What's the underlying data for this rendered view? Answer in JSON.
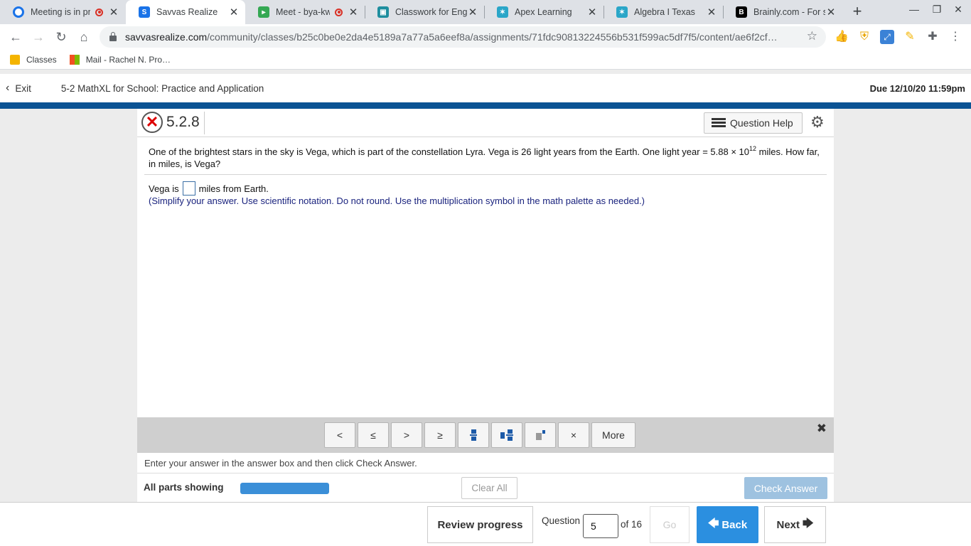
{
  "browser": {
    "tabs": [
      {
        "title": "Meeting is in pr",
        "favicon": "meeting-icon",
        "recording": true
      },
      {
        "title": "Savvas Realize",
        "favicon": "savvas-icon",
        "active": true
      },
      {
        "title": "Meet - bya-kwip",
        "favicon": "google-meet-icon",
        "recording": true
      },
      {
        "title": "Classwork for Engli",
        "favicon": "classroom-icon"
      },
      {
        "title": "Apex Learning",
        "favicon": "apex-icon"
      },
      {
        "title": "Algebra I Texas",
        "favicon": "apex-icon"
      },
      {
        "title": "Brainly.com - For st",
        "favicon": "brainly-icon"
      }
    ],
    "url_domain": "savvasrealize.com",
    "url_path": "/community/classes/b25c0be0e2da4e5189a7a77a5a6eef8a/assignments/71fdc90813224556b531f599ac5df7f5/content/ae6f2cf…",
    "bookmarks": [
      {
        "label": "Classes",
        "icon": "classroom-icon"
      },
      {
        "label": "Mail - Rachel N. Pro…",
        "icon": "microsoft-icon"
      }
    ]
  },
  "assignment": {
    "exit_label": "Exit",
    "title": "5-2 MathXL for School: Practice and Application",
    "due": "Due 12/10/20 11:59pm"
  },
  "question": {
    "number": "5.2.8",
    "help_label": "Question Help",
    "text_before": "One of the brightest stars in the sky is Vega, which is part of the constellation Lyra. Vega is 26 light years from the Earth. One light year = 5.88 × 10",
    "exponent": "12",
    "text_after": " miles. How far, in miles, is Vega?",
    "answer_prefix": "Vega is",
    "answer_suffix": "miles from Earth.",
    "hint": "(Simplify your answer. Use scientific notation. Do not round. Use the multiplication symbol in the math palette as needed.)"
  },
  "palette": {
    "buttons": [
      "<",
      "≤",
      ">",
      "≥",
      "×"
    ],
    "more_label": "More"
  },
  "footer": {
    "instruction": "Enter your answer in the answer box and then click Check Answer.",
    "all_parts": "All parts showing",
    "progress_fraction": 1.0,
    "clear_all": "Clear All",
    "check_answer": "Check Answer"
  },
  "nav": {
    "review": "Review progress",
    "question_label": "Question",
    "question_value": "5",
    "of_total": "of 16",
    "go": "Go",
    "back": "Back",
    "next": "Next"
  },
  "colors": {
    "accent": "#2b8fe0",
    "header_bar": "#0b5394",
    "hint_text": "#1a237e",
    "incorrect": "#dd0000"
  }
}
